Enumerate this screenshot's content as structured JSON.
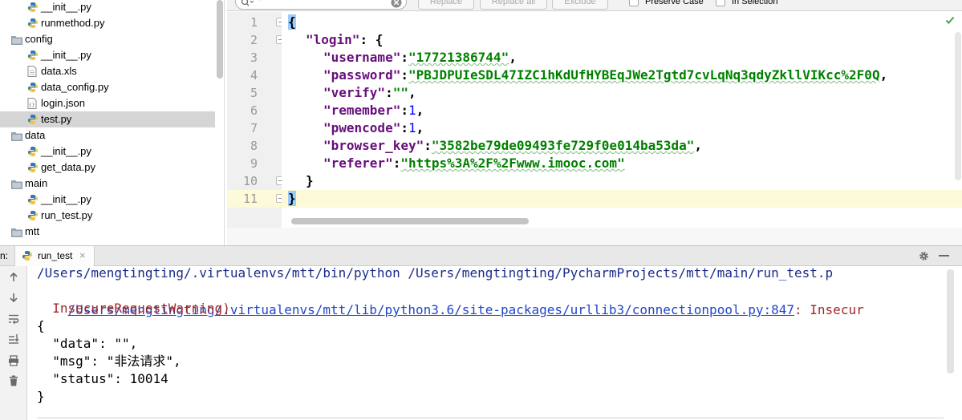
{
  "project_tree": {
    "items": [
      {
        "label": "__init__.py",
        "type": "python"
      },
      {
        "label": "runmethod.py",
        "type": "python"
      },
      {
        "label": "config",
        "type": "folder"
      },
      {
        "label": "__init__.py",
        "type": "python"
      },
      {
        "label": "data.xls",
        "type": "file"
      },
      {
        "label": "data_config.py",
        "type": "python"
      },
      {
        "label": "login.json",
        "type": "json"
      },
      {
        "label": "test.py",
        "type": "python",
        "selected": true
      },
      {
        "label": "data",
        "type": "folder"
      },
      {
        "label": "__init__.py",
        "type": "python"
      },
      {
        "label": "get_data.py",
        "type": "python"
      },
      {
        "label": "main",
        "type": "folder"
      },
      {
        "label": "__init__.py",
        "type": "python"
      },
      {
        "label": "run_test.py",
        "type": "python"
      },
      {
        "label": "mtt",
        "type": "folder"
      }
    ]
  },
  "find_bar": {
    "search_value": "\"",
    "replace_label": "Replace",
    "replace_all_label": "Replace all",
    "exclude_label": "Exclude",
    "preserve_case_label": "Preserve Case",
    "in_selection_label": "In Selection"
  },
  "editor": {
    "line_numbers": [
      "1",
      "2",
      "3",
      "4",
      "5",
      "6",
      "7",
      "8",
      "9",
      "10",
      "11"
    ],
    "login_key": "\"login\"",
    "fields": [
      {
        "key": "\"username\"",
        "value": "\"17721386744\"",
        "kind": "string"
      },
      {
        "key": "\"password\"",
        "value": "\"PBJDPUIeSDL47IZC1hKdUfHYBEqJWe2Tgtd7cvLqNq3qdyZkllVIKcc%2F0Q",
        "kind": "string"
      },
      {
        "key": "\"verify\"",
        "value": "\"\"",
        "kind": "string"
      },
      {
        "key": "\"remember\"",
        "value": "1",
        "kind": "number"
      },
      {
        "key": "\"pwencode\"",
        "value": "1",
        "kind": "number"
      },
      {
        "key": "\"browser_key\"",
        "value": "\"3582be79de09493fe729f0e014ba53da\"",
        "kind": "string"
      },
      {
        "key": "\"referer\"",
        "value": "\"https%3A%2F%2Fwww.imooc.com\"",
        "kind": "string"
      }
    ]
  },
  "run_panel": {
    "prefix": "n:",
    "tab_label": "run_test",
    "close_glyph": "×"
  },
  "console": {
    "line1": "/Users/mengtingting/.virtualenvs/mtt/bin/python /Users/mengtingting/PycharmProjects/mtt/main/run_test.p",
    "line2_link": "/Users/mengtingting/.virtualenvs/mtt/lib/python3.6/site-packages/urllib3/connectionpool.py:847",
    "line2_rest": ": Insecur",
    "line3": "  InsecureRequestWarning)",
    "line4": "{",
    "line5": "  \"data\": \"\",",
    "line6": "  \"msg\": \"非法请求\",",
    "line7": "  \"status\": 10014",
    "line8": "}"
  },
  "colors": {
    "json_key": "#660e7a",
    "json_string": "#008000",
    "json_number": "#0000ff",
    "console_link": "#2046c9",
    "console_warning": "#a12727"
  },
  "icons": [
    "folder-icon",
    "python-file-icon",
    "json-file-icon",
    "file-icon",
    "search-icon",
    "clear-icon",
    "check-icon",
    "gear-icon",
    "up-arrow-icon",
    "down-arrow-icon",
    "soft-wrap-icon",
    "scroll-to-end-icon",
    "print-icon",
    "trash-icon"
  ]
}
